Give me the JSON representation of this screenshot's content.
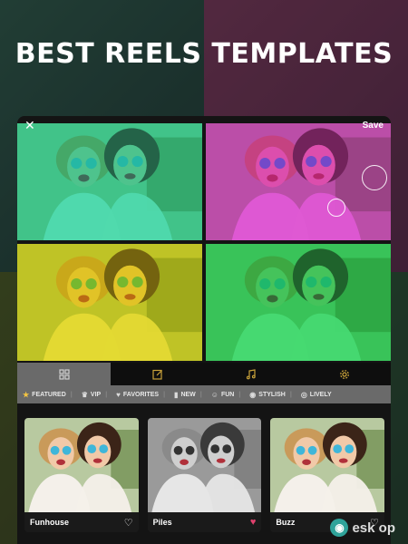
{
  "headline": "BEST REELS TEMPLATES",
  "topbar": {
    "close_icon": "close-icon",
    "save_label": "Save"
  },
  "preview": {
    "panels": [
      {
        "tint": "#3fe0b0"
      },
      {
        "tint": "#e24bdc"
      },
      {
        "tint": "#e8e020"
      },
      {
        "tint": "#34e06a"
      }
    ]
  },
  "tabs": [
    {
      "icon": "grid-icon",
      "active": true
    },
    {
      "icon": "edit-icon",
      "active": false
    },
    {
      "icon": "music-icon",
      "active": false
    },
    {
      "icon": "settings-icon",
      "active": false
    }
  ],
  "categories": [
    {
      "label": "FEATURED",
      "icon": "star-icon",
      "active": true
    },
    {
      "label": "VIP",
      "icon": "crown-icon"
    },
    {
      "label": "FAVORITES",
      "icon": "heart-icon"
    },
    {
      "label": "NEW",
      "icon": "bookmark-icon"
    },
    {
      "label": "FUN",
      "icon": "smile-icon"
    },
    {
      "label": "STYLISH",
      "icon": "stylish-icon"
    },
    {
      "label": "LIVELY",
      "icon": "lively-icon"
    }
  ],
  "templates": [
    {
      "name": "Funhouse",
      "favorite": false
    },
    {
      "name": "Piles",
      "favorite": true
    },
    {
      "name": "Buzz",
      "favorite": false
    }
  ],
  "watermark": {
    "text": "esk op"
  },
  "colors": {
    "accent": "#c9a23a",
    "favorite": "#e0416d",
    "featured_star": "#f4c542"
  }
}
